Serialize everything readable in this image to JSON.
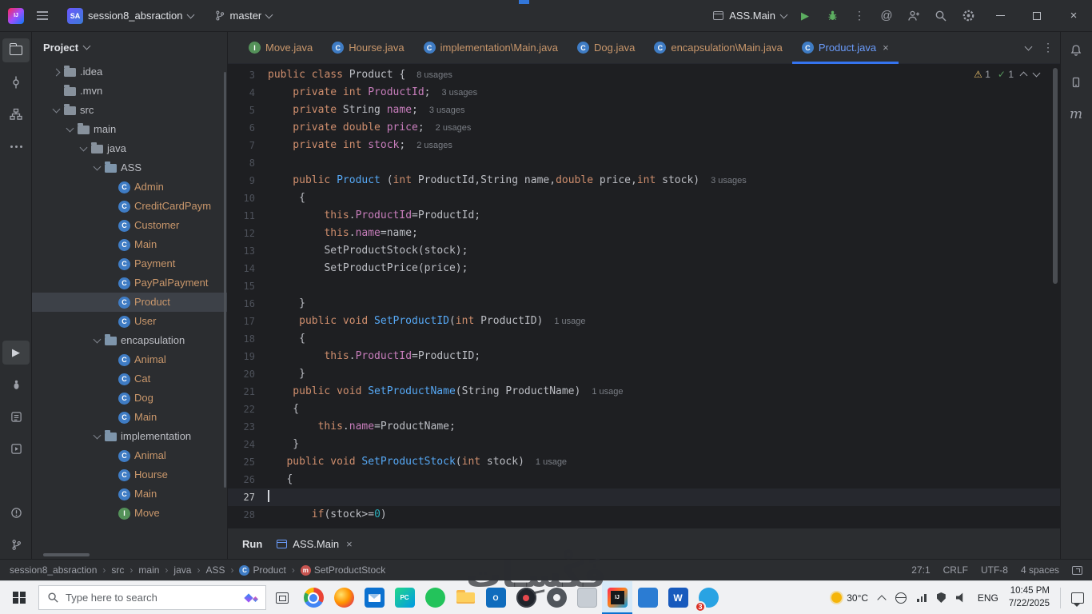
{
  "colors": {
    "accent": "#3574f0",
    "keyword": "#cf8e6d",
    "method": "#56a8f5",
    "field": "#c77dbb",
    "number": "#2aacb8",
    "file_label": "#c9976b",
    "warning": "#e8bf6a",
    "ok": "#57965c"
  },
  "titlebar": {
    "app_badge": "SA",
    "project_name": "session8_absraction",
    "branch_name": "master",
    "run_config_name": "ASS.Main"
  },
  "inspection": {
    "warnings": "1",
    "passed": "1"
  },
  "tabs": {
    "items": [
      {
        "label": "Move.java",
        "icon": "interface"
      },
      {
        "label": "Hourse.java",
        "icon": "class"
      },
      {
        "label": "implementation\\Main.java",
        "icon": "class"
      },
      {
        "label": "Dog.java",
        "icon": "class"
      },
      {
        "label": "encapsulation\\Main.java",
        "icon": "class"
      },
      {
        "label": "Product.java",
        "icon": "class",
        "active": true,
        "close": "×"
      }
    ]
  },
  "project": {
    "header": "Project",
    "tree": [
      {
        "label": ".idea",
        "lvl": 1,
        "ic": "folder",
        "ch": "r"
      },
      {
        "label": ".mvn",
        "lvl": 1,
        "ic": "folder",
        "ch": ""
      },
      {
        "label": "src",
        "lvl": 1,
        "ic": "folder",
        "ch": "d"
      },
      {
        "label": "main",
        "lvl": 2,
        "ic": "folder",
        "ch": "d"
      },
      {
        "label": "java",
        "lvl": 3,
        "ic": "folder",
        "ch": "d"
      },
      {
        "label": "ASS",
        "lvl": 4,
        "ic": "pkg",
        "ch": "d"
      },
      {
        "label": "Admin",
        "lvl": 5,
        "ic": "class"
      },
      {
        "label": "CreditCardPaym",
        "lvl": 5,
        "ic": "class"
      },
      {
        "label": "Customer",
        "lvl": 5,
        "ic": "class"
      },
      {
        "label": "Main",
        "lvl": 5,
        "ic": "class"
      },
      {
        "label": "Payment",
        "lvl": 5,
        "ic": "class"
      },
      {
        "label": "PayPalPayment",
        "lvl": 5,
        "ic": "class"
      },
      {
        "label": "Product",
        "lvl": 5,
        "ic": "class",
        "sel": true
      },
      {
        "label": "User",
        "lvl": 5,
        "ic": "class"
      },
      {
        "label": "encapsulation",
        "lvl": 4,
        "ic": "pkg",
        "ch": "d"
      },
      {
        "label": "Animal",
        "lvl": 5,
        "ic": "class"
      },
      {
        "label": "Cat",
        "lvl": 5,
        "ic": "class"
      },
      {
        "label": "Dog",
        "lvl": 5,
        "ic": "class"
      },
      {
        "label": "Main",
        "lvl": 5,
        "ic": "class"
      },
      {
        "label": "implementation",
        "lvl": 4,
        "ic": "pkg",
        "ch": "d"
      },
      {
        "label": "Animal",
        "lvl": 5,
        "ic": "class"
      },
      {
        "label": "Hourse",
        "lvl": 5,
        "ic": "class"
      },
      {
        "label": "Main",
        "lvl": 5,
        "ic": "class"
      },
      {
        "label": "Move",
        "lvl": 5,
        "ic": "iface"
      }
    ]
  },
  "editor": {
    "lines": [
      {
        "n": 3,
        "i": 0,
        "t": [
          [
            "k",
            "public class "
          ],
          [
            "p",
            "Product {"
          ]
        ],
        "h": "8 usages"
      },
      {
        "n": 4,
        "i": 4,
        "t": [
          [
            "k",
            "private int "
          ],
          [
            "f",
            "ProductId"
          ],
          [
            "p",
            ";"
          ]
        ],
        "h": "3 usages"
      },
      {
        "n": 5,
        "i": 4,
        "t": [
          [
            "k",
            "private "
          ],
          [
            "c",
            "String "
          ],
          [
            "f",
            "name"
          ],
          [
            "p",
            ";"
          ]
        ],
        "h": "3 usages"
      },
      {
        "n": 6,
        "i": 4,
        "t": [
          [
            "k",
            "private double "
          ],
          [
            "f",
            "price"
          ],
          [
            "p",
            ";"
          ]
        ],
        "h": "2 usages"
      },
      {
        "n": 7,
        "i": 4,
        "t": [
          [
            "k",
            "private int "
          ],
          [
            "f",
            "stock"
          ],
          [
            "p",
            ";"
          ]
        ],
        "h": "2 usages"
      },
      {
        "n": 8,
        "i": 0,
        "t": []
      },
      {
        "n": 9,
        "i": 4,
        "t": [
          [
            "k",
            "public "
          ],
          [
            "m",
            "Product "
          ],
          [
            "p",
            "("
          ],
          [
            "k",
            "int"
          ],
          [
            "p",
            " ProductId,"
          ],
          [
            "c",
            "String"
          ],
          [
            "p",
            " name,"
          ],
          [
            "k",
            "double"
          ],
          [
            "p",
            " price,"
          ],
          [
            "k",
            "int"
          ],
          [
            "p",
            " stock)"
          ]
        ],
        "h": "3 usages"
      },
      {
        "n": 10,
        "i": 5,
        "t": [
          [
            "p",
            "{"
          ]
        ]
      },
      {
        "n": 11,
        "i": 9,
        "t": [
          [
            "k",
            "this"
          ],
          [
            "p",
            "."
          ],
          [
            "f",
            "ProductId"
          ],
          [
            "p",
            "=ProductId;"
          ]
        ]
      },
      {
        "n": 12,
        "i": 9,
        "t": [
          [
            "k",
            "this"
          ],
          [
            "p",
            "."
          ],
          [
            "f",
            "name"
          ],
          [
            "p",
            "=name;"
          ]
        ]
      },
      {
        "n": 13,
        "i": 9,
        "t": [
          [
            "p",
            "SetProductStock(stock);"
          ]
        ]
      },
      {
        "n": 14,
        "i": 9,
        "t": [
          [
            "p",
            "SetProductPrice(price);"
          ]
        ]
      },
      {
        "n": 15,
        "i": 0,
        "t": []
      },
      {
        "n": 16,
        "i": 5,
        "t": [
          [
            "p",
            "}"
          ]
        ]
      },
      {
        "n": 17,
        "i": 5,
        "t": [
          [
            "k",
            "public void "
          ],
          [
            "m",
            "SetProductID"
          ],
          [
            "p",
            "("
          ],
          [
            "k",
            "int"
          ],
          [
            "p",
            " ProductID)"
          ]
        ],
        "h": "1 usage"
      },
      {
        "n": 18,
        "i": 5,
        "t": [
          [
            "p",
            "{"
          ]
        ]
      },
      {
        "n": 19,
        "i": 9,
        "t": [
          [
            "k",
            "this"
          ],
          [
            "p",
            "."
          ],
          [
            "f",
            "ProductId"
          ],
          [
            "p",
            "=ProductID;"
          ]
        ]
      },
      {
        "n": 20,
        "i": 5,
        "t": [
          [
            "p",
            "}"
          ]
        ]
      },
      {
        "n": 21,
        "i": 4,
        "t": [
          [
            "k",
            "public void "
          ],
          [
            "m",
            "SetProductName"
          ],
          [
            "p",
            "("
          ],
          [
            "c",
            "String"
          ],
          [
            "p",
            " ProductName)"
          ]
        ],
        "h": "1 usage"
      },
      {
        "n": 22,
        "i": 4,
        "t": [
          [
            "p",
            "{"
          ]
        ]
      },
      {
        "n": 23,
        "i": 8,
        "t": [
          [
            "k",
            "this"
          ],
          [
            "p",
            "."
          ],
          [
            "f",
            "name"
          ],
          [
            "p",
            "=ProductName;"
          ]
        ]
      },
      {
        "n": 24,
        "i": 4,
        "t": [
          [
            "p",
            "}"
          ]
        ]
      },
      {
        "n": 25,
        "i": 3,
        "t": [
          [
            "k",
            "public void "
          ],
          [
            "m",
            "SetProductStock"
          ],
          [
            "p",
            "("
          ],
          [
            "k",
            "int"
          ],
          [
            "p",
            " stock)"
          ]
        ],
        "h": "1 usage"
      },
      {
        "n": 26,
        "i": 3,
        "t": [
          [
            "p",
            "{"
          ]
        ]
      },
      {
        "n": 27,
        "i": 0,
        "t": [],
        "caret": true,
        "cur": true
      },
      {
        "n": 28,
        "i": 7,
        "t": [
          [
            "k",
            "if"
          ],
          [
            "p",
            "(stock>="
          ],
          [
            "num",
            "0"
          ],
          [
            "p",
            ")"
          ]
        ]
      }
    ]
  },
  "run_panel": {
    "title": "Run",
    "tab_label": "ASS.Main",
    "tab_close": "×"
  },
  "statusbar": {
    "crumbs": [
      {
        "label": "session8_absraction"
      },
      {
        "label": "src"
      },
      {
        "label": "main"
      },
      {
        "label": "java"
      },
      {
        "label": "ASS"
      },
      {
        "label": "Product",
        "ic": "class"
      },
      {
        "label": "SetProductStock",
        "ic": "method"
      }
    ],
    "caret_pos": "27:1",
    "line_ending": "CRLF",
    "encoding": "UTF-8",
    "indent": "4 spaces"
  },
  "taskbar": {
    "search_placeholder": "Type here to search",
    "apps": [
      {
        "name": "chrome",
        "kind": "chrome"
      },
      {
        "name": "firefox",
        "kind": "firefox"
      },
      {
        "name": "mail",
        "kind": "mail"
      },
      {
        "name": "pycharm",
        "kind": "pycharm",
        "text": "PC"
      },
      {
        "name": "green-app",
        "kind": "green"
      },
      {
        "name": "file-explorer",
        "kind": "folder"
      },
      {
        "name": "outlook",
        "kind": "outlook",
        "text": "O"
      },
      {
        "name": "recorder",
        "kind": "obs"
      },
      {
        "name": "settings",
        "kind": "gear"
      },
      {
        "name": "gray-app",
        "kind": "gray"
      },
      {
        "name": "intellij-idea",
        "kind": "idea",
        "active": true
      },
      {
        "name": "blue-app",
        "kind": "blue"
      },
      {
        "name": "word",
        "kind": "word",
        "text": "W"
      },
      {
        "name": "chat",
        "kind": "chat",
        "badge": "3"
      }
    ],
    "temperature": "30°C",
    "language": "ENG",
    "time": "10:45 PM",
    "date": "7/22/2025"
  },
  "watermark": "فَكْسِـات"
}
